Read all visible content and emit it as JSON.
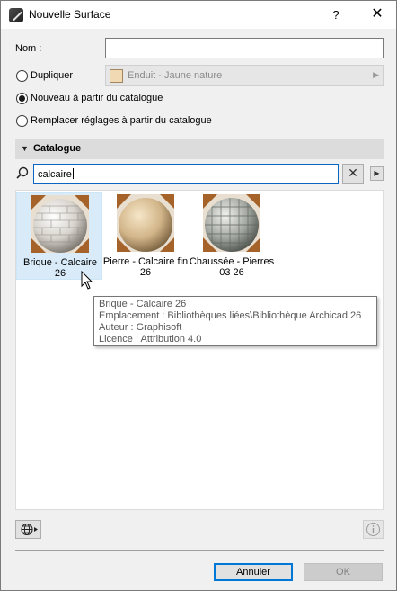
{
  "window": {
    "title": "Nouvelle Surface",
    "help_label": "?",
    "close_label": "✕"
  },
  "name_field": {
    "label": "Nom :",
    "value": ""
  },
  "options": {
    "duplicate_label": "Dupliquer",
    "duplicate_selected": false,
    "new_from_catalog_label": "Nouveau à partir du catalogue",
    "new_from_catalog_selected": true,
    "replace_label": "Remplacer réglages à partir du catalogue",
    "replace_selected": false
  },
  "surface_select": {
    "value": "Enduit - Jaune nature",
    "swatch_color": "#f1d9b4",
    "enabled": false
  },
  "catalog": {
    "header": "Catalogue",
    "expanded": true,
    "search_value": "calcaire",
    "clear_label": "✕",
    "items": [
      {
        "name": "Brique - Calcaire 26",
        "selected": true,
        "icon": "brick-sphere-thumbnail"
      },
      {
        "name": "Pierre - Calcaire fin 26",
        "selected": false,
        "icon": "stone-sphere-thumbnail"
      },
      {
        "name": "Chaussée - Pierres 03 26",
        "selected": false,
        "icon": "pavement-sphere-thumbnail"
      }
    ]
  },
  "tooltip": {
    "line1": "Brique - Calcaire 26",
    "line2": "Emplacement : Bibliothèques liées\\Bibliothèque Archicad 26",
    "line3": "Auteur : Graphisoft",
    "line4": "Licence : Attribution 4.0"
  },
  "footer": {
    "cancel_label": "Annuler",
    "ok_label": "OK",
    "ok_enabled": false
  },
  "colors": {
    "dialog_bg": "#f0f0f0",
    "selection_bg": "#d9ebf9",
    "accent": "#0078d7"
  }
}
